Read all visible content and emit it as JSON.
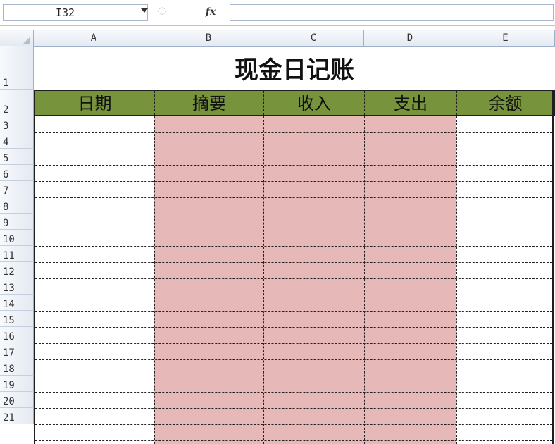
{
  "formula_bar": {
    "name_box": "I32",
    "fx_label": "fx",
    "formula_value": ""
  },
  "columns": [
    "A",
    "B",
    "C",
    "D",
    "E"
  ],
  "rows": [
    "1",
    "2",
    "3",
    "4",
    "5",
    "6",
    "7",
    "8",
    "9",
    "10",
    "11",
    "12",
    "13",
    "14",
    "15",
    "16",
    "17",
    "18",
    "19",
    "20",
    "21"
  ],
  "sheet": {
    "title": "现金日记账",
    "headers": [
      "日期",
      "摘要",
      "收入",
      "支出",
      "余额"
    ]
  },
  "colors": {
    "header_fill": "#77933c",
    "shaded_columns": "#e6b8b7",
    "border": "#1f1f1f"
  }
}
